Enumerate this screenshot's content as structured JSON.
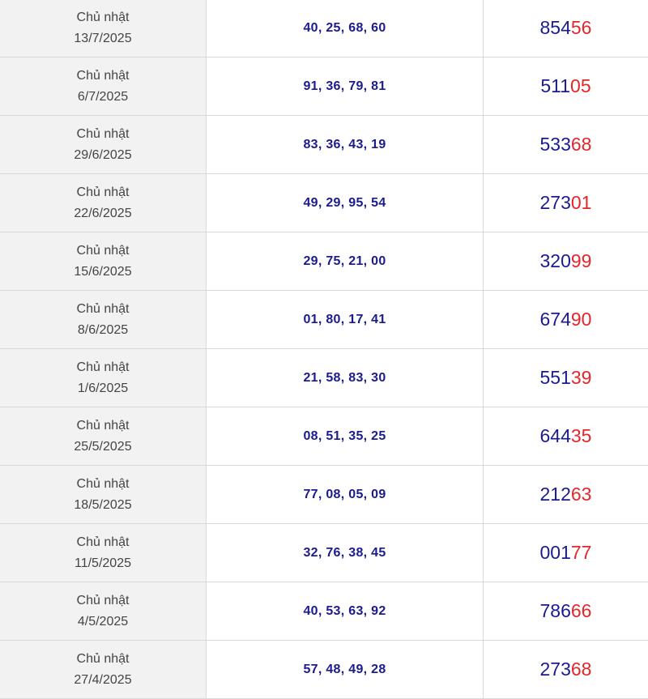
{
  "colors": {
    "date_bg": "#f2f2f2",
    "numbers_blue": "#1b1b8f",
    "special_red": "#e3262a",
    "border": "#d9d9d9"
  },
  "rows": [
    {
      "day": "Chủ nhật",
      "date": "13/7/2025",
      "numbers": "40, 25, 68, 60",
      "special_head": "854",
      "special_tail": "56"
    },
    {
      "day": "Chủ nhật",
      "date": "6/7/2025",
      "numbers": "91, 36, 79, 81",
      "special_head": "511",
      "special_tail": "05"
    },
    {
      "day": "Chủ nhật",
      "date": "29/6/2025",
      "numbers": "83, 36, 43, 19",
      "special_head": "533",
      "special_tail": "68"
    },
    {
      "day": "Chủ nhật",
      "date": "22/6/2025",
      "numbers": "49, 29, 95, 54",
      "special_head": "273",
      "special_tail": "01"
    },
    {
      "day": "Chủ nhật",
      "date": "15/6/2025",
      "numbers": "29, 75, 21, 00",
      "special_head": "320",
      "special_tail": "99"
    },
    {
      "day": "Chủ nhật",
      "date": "8/6/2025",
      "numbers": "01, 80, 17, 41",
      "special_head": "674",
      "special_tail": "90"
    },
    {
      "day": "Chủ nhật",
      "date": "1/6/2025",
      "numbers": "21, 58, 83, 30",
      "special_head": "551",
      "special_tail": "39"
    },
    {
      "day": "Chủ nhật",
      "date": "25/5/2025",
      "numbers": "08, 51, 35, 25",
      "special_head": "644",
      "special_tail": "35"
    },
    {
      "day": "Chủ nhật",
      "date": "18/5/2025",
      "numbers": "77, 08, 05, 09",
      "special_head": "212",
      "special_tail": "63"
    },
    {
      "day": "Chủ nhật",
      "date": "11/5/2025",
      "numbers": "32, 76, 38, 45",
      "special_head": "001",
      "special_tail": "77"
    },
    {
      "day": "Chủ nhật",
      "date": "4/5/2025",
      "numbers": "40, 53, 63, 92",
      "special_head": "786",
      "special_tail": "66"
    },
    {
      "day": "Chủ nhật",
      "date": "27/4/2025",
      "numbers": "57, 48, 49, 28",
      "special_head": "273",
      "special_tail": "68"
    }
  ]
}
